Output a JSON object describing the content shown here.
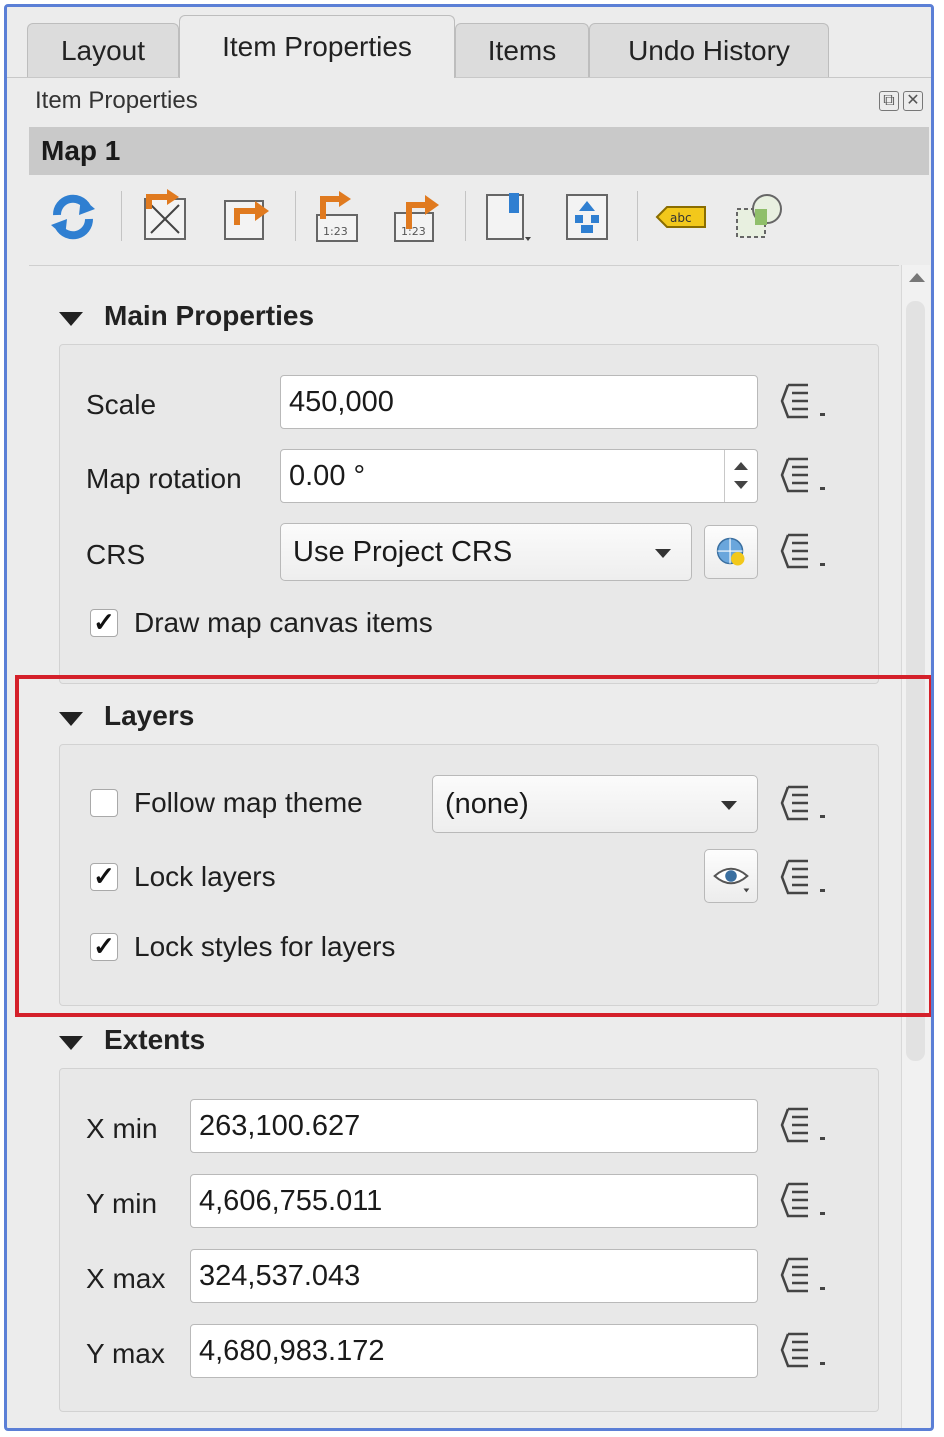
{
  "tabs": [
    {
      "label": "Layout",
      "active": false
    },
    {
      "label": "Item Properties",
      "active": true
    },
    {
      "label": "Items",
      "active": false
    },
    {
      "label": "Undo History",
      "active": false
    }
  ],
  "panel": {
    "title": "Item Properties",
    "item_name": "Map 1"
  },
  "toolbar": {
    "icons": [
      "refresh-icon",
      "set-extent-icon",
      "view-extent-icon",
      "set-scale-icon",
      "view-scale-icon",
      "bookmark-icon",
      "atlas-icon",
      "labels-icon",
      "clip-icon"
    ]
  },
  "main_properties": {
    "title": "Main Properties",
    "scale_label": "Scale",
    "scale_value": "450,000",
    "rotation_label": "Map rotation",
    "rotation_value": "0.00 °",
    "crs_label": "CRS",
    "crs_value": "Use Project CRS",
    "draw_items_label": "Draw map canvas items",
    "draw_items_checked": true
  },
  "layers": {
    "title": "Layers",
    "follow_theme_label": "Follow map theme",
    "follow_theme_checked": false,
    "theme_value": "(none)",
    "lock_layers_label": "Lock layers",
    "lock_layers_checked": true,
    "lock_styles_label": "Lock styles for layers",
    "lock_styles_checked": true
  },
  "extents": {
    "title": "Extents",
    "xmin_label": "X min",
    "xmin_value": "263,100.627",
    "ymin_label": "Y min",
    "ymin_value": "4,606,755.011",
    "xmax_label": "X max",
    "xmax_value": "324,537.043",
    "ymax_label": "Y max",
    "ymax_value": "4,680,983.172"
  },
  "colors": {
    "highlight": "#d4202a",
    "frame_border": "#5b7fd6",
    "icon_orange": "#e07a1f",
    "icon_blue": "#2f7fd1"
  }
}
